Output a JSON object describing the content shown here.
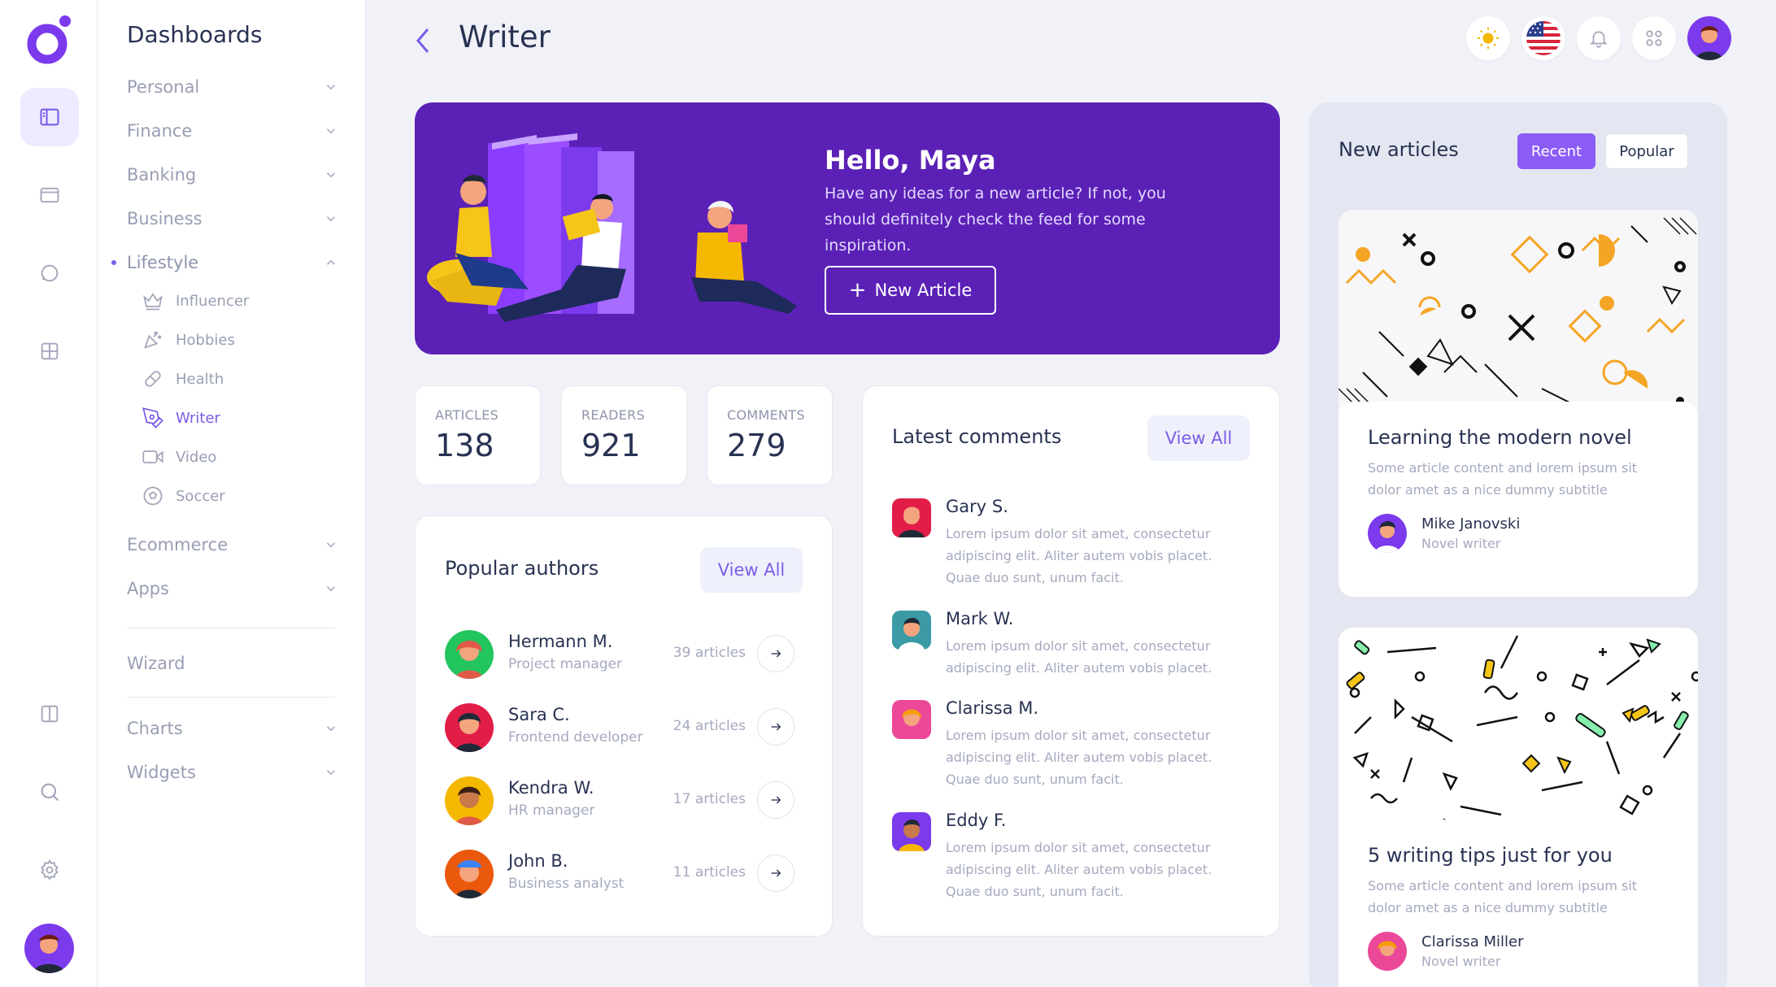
{
  "colors": {
    "accent": "#7c5ce6",
    "banner": "#5b21b6",
    "tab_active": "#8b5cf6"
  },
  "sidebar": {
    "title": "Dashboards",
    "items": [
      {
        "label": "Personal"
      },
      {
        "label": "Finance"
      },
      {
        "label": "Banking"
      },
      {
        "label": "Business"
      },
      {
        "label": "Lifestyle"
      }
    ],
    "lifestyle_sub": [
      {
        "label": "Influencer",
        "icon": "crown-icon"
      },
      {
        "label": "Hobbies",
        "icon": "party-icon"
      },
      {
        "label": "Health",
        "icon": "pill-icon"
      },
      {
        "label": "Writer",
        "icon": "pen-icon"
      },
      {
        "label": "Video",
        "icon": "video-icon"
      },
      {
        "label": "Soccer",
        "icon": "soccer-ball-icon"
      }
    ],
    "items2": [
      {
        "label": "Ecommerce"
      },
      {
        "label": "Apps"
      }
    ],
    "wizard": "Wizard",
    "items3": [
      {
        "label": "Charts"
      },
      {
        "label": "Widgets"
      }
    ]
  },
  "header": {
    "title": "Writer"
  },
  "banner": {
    "title": "Hello, Maya",
    "text": "Have any ideas for a new article? If not, you should definitely check the feed for some inspiration.",
    "button": "New Article"
  },
  "stats": [
    {
      "label": "ARTICLES",
      "value": "138"
    },
    {
      "label": "READERS",
      "value": "921"
    },
    {
      "label": "COMMENTS",
      "value": "279"
    }
  ],
  "authors": {
    "title": "Popular authors",
    "view_all": "View All",
    "list": [
      {
        "name": "Hermann M.",
        "role": "Project manager",
        "count": "39 articles"
      },
      {
        "name": "Sara C.",
        "role": "Frontend developer",
        "count": "24 articles"
      },
      {
        "name": "Kendra W.",
        "role": "HR manager",
        "count": "17 articles"
      },
      {
        "name": "John B.",
        "role": "Business analyst",
        "count": "11 articles"
      }
    ]
  },
  "comments": {
    "title": "Latest comments",
    "view_all": "View All",
    "list": [
      {
        "name": "Gary S.",
        "text": "Lorem ipsum dolor sit amet, consectetur adipiscing elit. Aliter autem vobis placet. Quae duo sunt, unum facit."
      },
      {
        "name": "Mark W.",
        "text": "Lorem ipsum dolor sit amet, consectetur adipiscing elit. Aliter autem vobis placet."
      },
      {
        "name": "Clarissa M.",
        "text": "Lorem ipsum dolor sit amet, consectetur adipiscing elit. Aliter autem vobis placet. Quae duo sunt, unum facit."
      },
      {
        "name": "Eddy F.",
        "text": "Lorem ipsum dolor sit amet, consectetur adipiscing elit. Aliter autem vobis placet. Quae duo sunt, unum facit."
      }
    ]
  },
  "new_articles": {
    "title": "New articles",
    "tab_recent": "Recent",
    "tab_popular": "Popular",
    "list": [
      {
        "title": "Learning the modern novel",
        "subtitle": "Some article content and lorem ipsum sit dolor amet as a nice dummy subtitle",
        "author": "Mike Janovski",
        "role": "Novel writer"
      },
      {
        "title": "5 writing tips just for you",
        "subtitle": "Some article content and lorem ipsum sit dolor amet as a nice dummy subtitle",
        "author": "Clarissa Miller",
        "role": "Novel writer"
      }
    ]
  }
}
